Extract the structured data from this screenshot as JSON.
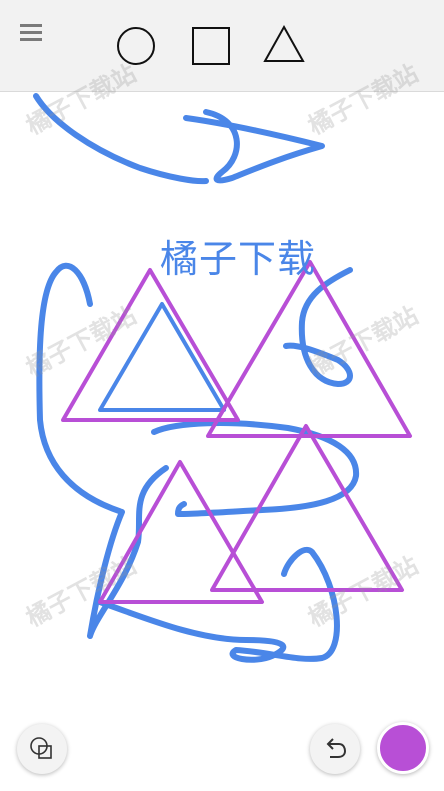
{
  "toolbar": {
    "menu_icon": "hamburger-icon",
    "shapes": [
      {
        "name": "circle",
        "icon": "circle-icon",
        "selected": false
      },
      {
        "name": "square",
        "icon": "square-icon",
        "selected": false
      },
      {
        "name": "triangle",
        "icon": "triangle-icon",
        "selected": true
      }
    ]
  },
  "canvas": {
    "text": "橘子下载",
    "text_color": "#4a86e8",
    "pen_color": "#4a86e8",
    "triangle_color": "#b84fd6"
  },
  "bottom_bar": {
    "shapes_icon": "layers-icon",
    "undo_icon": "undo-icon",
    "current_color": "#b84fd6"
  },
  "watermark": "橘子下载站"
}
